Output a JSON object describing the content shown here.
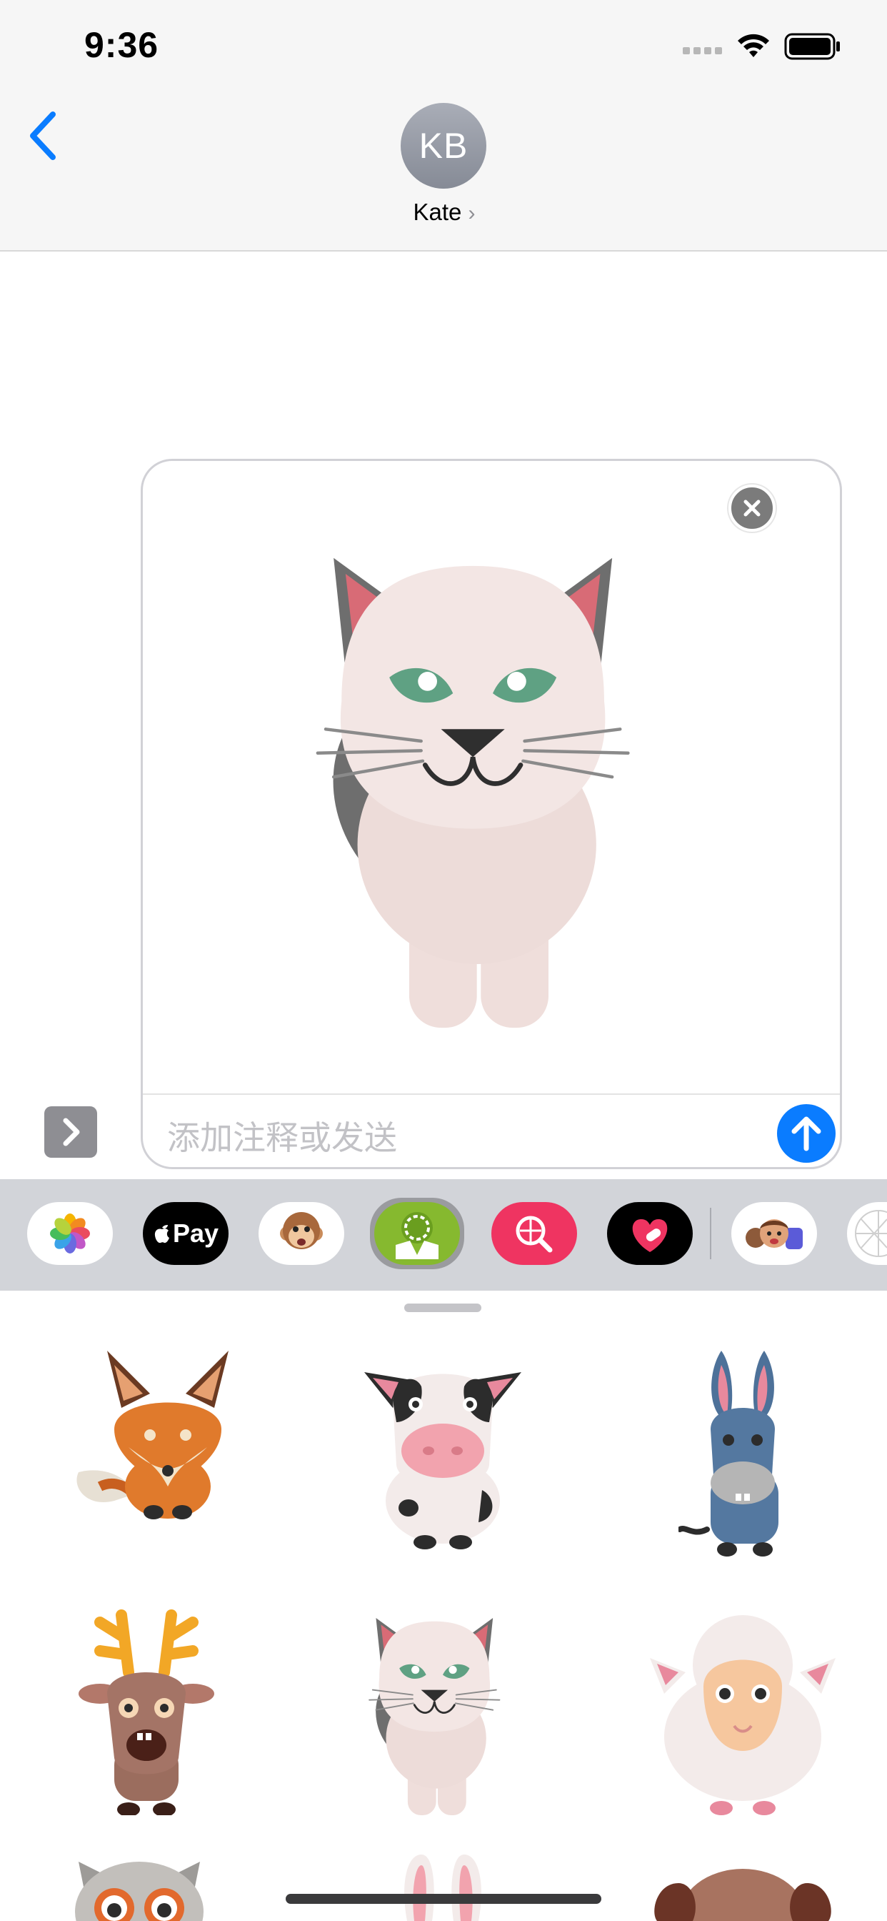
{
  "status_bar": {
    "time": "9:36",
    "icons": [
      "cellular-signal-icon",
      "wifi-icon",
      "battery-icon"
    ]
  },
  "nav": {
    "back_icon": "chevron-left-icon",
    "avatar_initials": "KB",
    "contact_name": "Kate",
    "contact_chevron": "›"
  },
  "compose": {
    "attached_sticker": "cat",
    "remove_icon": "close-icon",
    "placeholder": "添加注释或发送",
    "send_icon": "arrow-up-icon",
    "expand_icon": "chevron-right-icon"
  },
  "app_drawer": {
    "apps": [
      {
        "name": "Photos",
        "icon": "photos-icon"
      },
      {
        "name": "Apple Pay",
        "label": "Pay",
        "icon": "apple-pay-icon"
      },
      {
        "name": "Animoji",
        "icon": "monkey-animoji-icon"
      },
      {
        "name": "Sticker app",
        "icon": "sticker-app-icon",
        "selected": true
      },
      {
        "name": "Image search",
        "icon": "globe-search-icon"
      },
      {
        "name": "Digital Touch",
        "icon": "heart-touch-icon"
      },
      {
        "name": "Memoji",
        "icon": "memoji-icon"
      },
      {
        "name": "More apps",
        "icon": "more-apps-icon"
      }
    ]
  },
  "stickers": [
    "fox",
    "cow",
    "donkey",
    "deer",
    "cat",
    "sheep",
    "owl",
    "rabbit",
    "dog"
  ],
  "colors": {
    "accent": "#0a7cff",
    "cat_body": "#f3e6e4",
    "cat_ears": "#6e6e6e",
    "cat_eyes": "#5fa183"
  }
}
